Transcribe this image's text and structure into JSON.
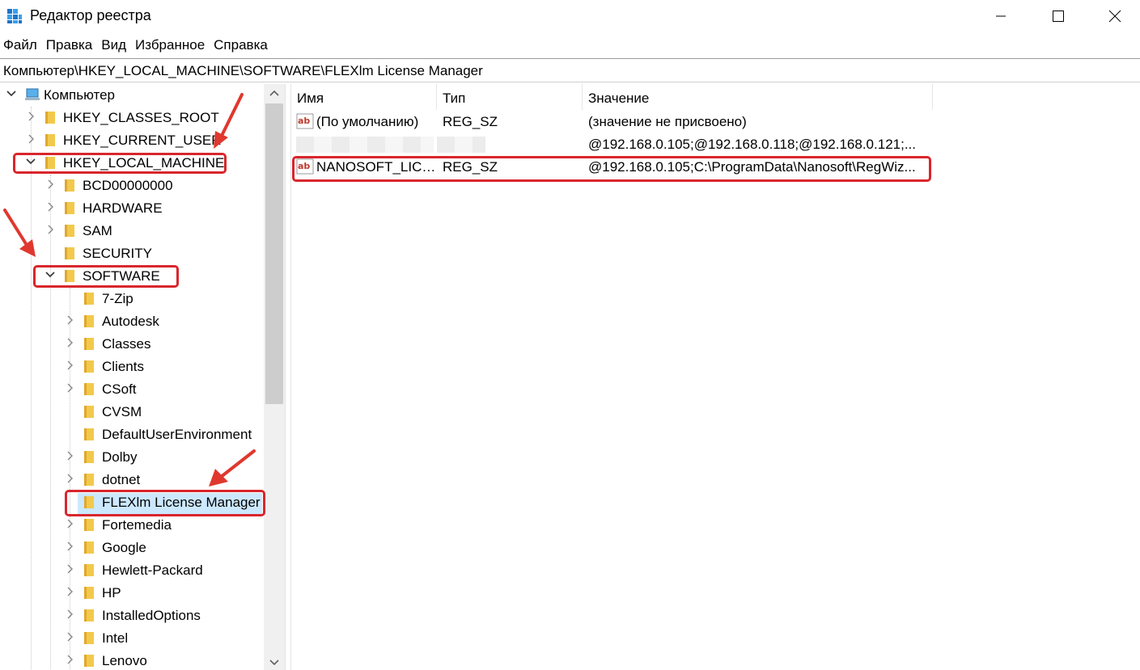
{
  "window": {
    "title": "Редактор реестра",
    "controls": {
      "minimize": "—",
      "maximize": "☐",
      "close": "✕"
    }
  },
  "menu": [
    "Файл",
    "Правка",
    "Вид",
    "Избранное",
    "Справка"
  ],
  "address": "Компьютер\\HKEY_LOCAL_MACHINE\\SOFTWARE\\FLEXlm License Manager",
  "tree": {
    "root": "Компьютер",
    "hives": [
      "HKEY_CLASSES_ROOT",
      "HKEY_CURRENT_USER",
      "HKEY_LOCAL_MACHINE"
    ],
    "hklm_children": [
      "BCD00000000",
      "HARDWARE",
      "SAM",
      "SECURITY",
      "SOFTWARE"
    ],
    "software_children": [
      "7-Zip",
      "Autodesk",
      "Classes",
      "Clients",
      "CSoft",
      "CVSM",
      "DefaultUserEnvironment",
      "Dolby",
      "dotnet",
      "FLEXlm License Manager",
      "Fortemedia",
      "Google",
      "Hewlett-Packard",
      "HP",
      "InstalledOptions",
      "Intel",
      "Lenovo"
    ],
    "selected": "FLEXlm License Manager"
  },
  "list": {
    "columns": [
      "Имя",
      "Тип",
      "Значение"
    ],
    "rows": [
      {
        "name": "(По умолчанию)",
        "type": "REG_SZ",
        "value": "(значение не присвоено)",
        "icon": "string-value-icon"
      },
      {
        "name": "",
        "type": "",
        "value": "@192.168.0.105;@192.168.0.118;@192.168.0.121;...",
        "icon": ""
      },
      {
        "name": "NANOSOFT_LICE...",
        "type": "REG_SZ",
        "value": "@192.168.0.105;C:\\ProgramData\\Nanosoft\\RegWiz...",
        "icon": "string-value-icon"
      }
    ]
  },
  "colors": {
    "highlight": "#d9262c",
    "selection": "#cce8ff",
    "folder": "#f2c94c"
  }
}
